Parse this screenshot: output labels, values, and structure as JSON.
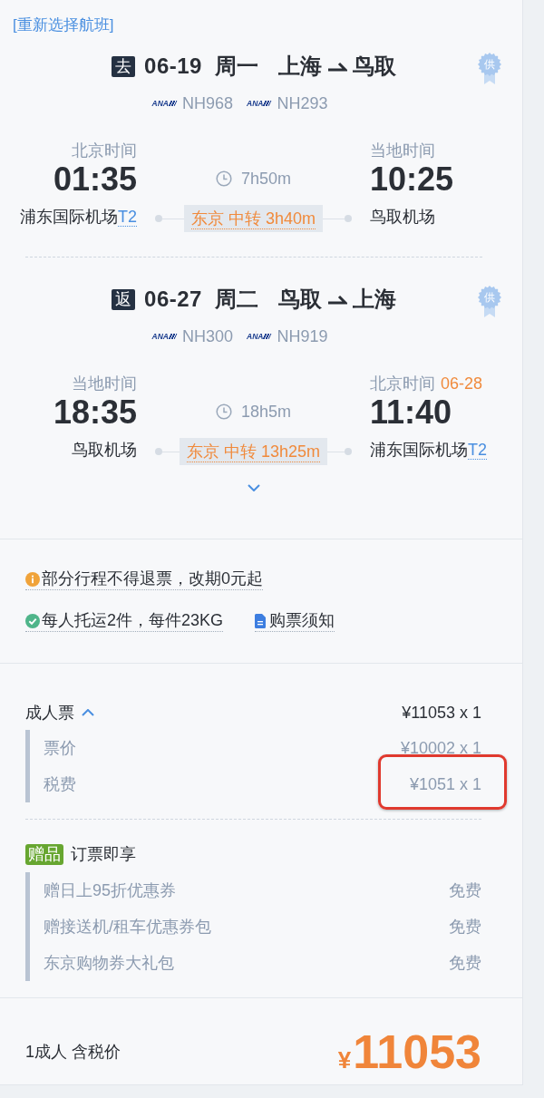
{
  "reselect_link": "[重新选择航班]",
  "segments": [
    {
      "direction": "去",
      "date": "06-19",
      "weekday": "周一",
      "origin": "上海",
      "destination": "鸟取",
      "supplier_badge": "供",
      "flights": [
        {
          "airline_logo": "ANA",
          "number": "NH968"
        },
        {
          "airline_logo": "ANA",
          "number": "NH293"
        }
      ],
      "departure": {
        "time_label": "北京时间",
        "time": "01:35",
        "airport": "浦东国际机场",
        "terminal": "T2"
      },
      "arrival": {
        "time_label": "当地时间",
        "time": "10:25",
        "airport": "鸟取机场"
      },
      "duration": "7h50m",
      "transfer": "东京 中转 3h40m"
    },
    {
      "direction": "返",
      "date": "06-27",
      "weekday": "周二",
      "origin": "鸟取",
      "destination": "上海",
      "supplier_badge": "供",
      "flights": [
        {
          "airline_logo": "ANA",
          "number": "NH300"
        },
        {
          "airline_logo": "ANA",
          "number": "NH919"
        }
      ],
      "departure": {
        "time_label": "当地时间",
        "time": "18:35",
        "airport": "鸟取机场"
      },
      "arrival": {
        "time_label": "北京时间",
        "date_change": "06-28",
        "time": "11:40",
        "airport": "浦东国际机场",
        "terminal": "T2"
      },
      "duration": "18h5m",
      "transfer": "东京 中转 13h25m"
    }
  ],
  "details_toggle": {
    "expanded": false
  },
  "notice_rows": [
    [
      {
        "kind": "warning",
        "text": "部分行程不得退票，改期0元起"
      }
    ],
    [
      {
        "kind": "baggage",
        "text": "每人托运2件，每件23KG"
      },
      {
        "kind": "document",
        "text": "购票须知"
      }
    ]
  ],
  "fare": {
    "label": "成人票",
    "expanded": true,
    "amount": "¥11053 x 1",
    "items": [
      {
        "label": "票价",
        "amount": "¥10002 x 1",
        "highlighted": false
      },
      {
        "label": "税费",
        "amount": "¥1051 x 1",
        "highlighted": true
      }
    ]
  },
  "gifts": {
    "badge": "赠品",
    "title": "订票即享",
    "items": [
      {
        "name": "赠日上95折优惠券",
        "price": "免费"
      },
      {
        "name": "赠接送机/租车优惠券包",
        "price": "免费"
      },
      {
        "name": "东京购物券大礼包",
        "price": "免费"
      }
    ]
  },
  "total": {
    "label": "1成人 含税价",
    "currency": "¥",
    "amount": "11053"
  }
}
